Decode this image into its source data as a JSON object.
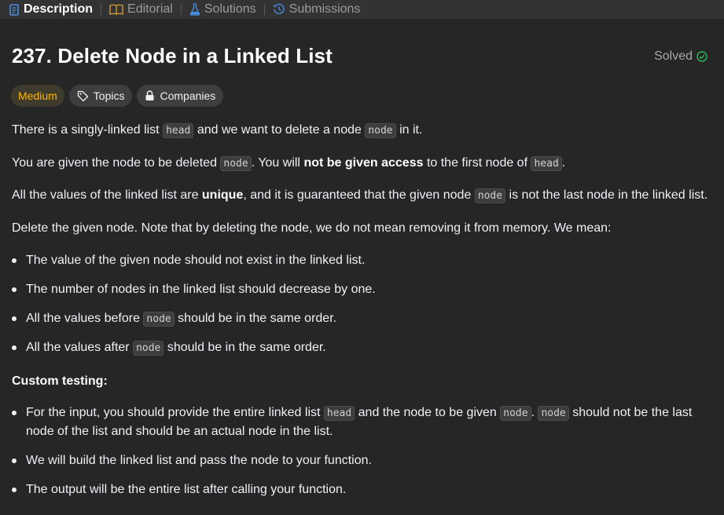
{
  "tabs": [
    {
      "label": "Description",
      "icon": "description-icon",
      "active": true
    },
    {
      "label": "Editorial",
      "icon": "book-icon",
      "active": false
    },
    {
      "label": "Solutions",
      "icon": "flask-icon",
      "active": false
    },
    {
      "label": "Submissions",
      "icon": "history-icon",
      "active": false
    }
  ],
  "problem": {
    "title": "237. Delete Node in a Linked List",
    "status": "Solved",
    "difficulty": "Medium",
    "topics_label": "Topics",
    "companies_label": "Companies"
  },
  "text": {
    "p1a": "There is a singly-linked list ",
    "p1code1": "head",
    "p1b": " and we want to delete a node ",
    "p1code2": "node",
    "p1c": " in it.",
    "p2a": "You are given the node to be deleted ",
    "p2code1": "node",
    "p2b": ". You will ",
    "p2bold": "not be given access",
    "p2c": " to the first node of ",
    "p2code2": "head",
    "p2d": ".",
    "p3a": "All the values of the linked list are ",
    "p3bold": "unique",
    "p3b": ", and it is guaranteed that the given node ",
    "p3code": "node",
    "p3c": " is not the last node in the linked list.",
    "p4": "Delete the given node. Note that by deleting the node, we do not mean removing it from memory. We mean:",
    "b1": "The value of the given node should not exist in the linked list.",
    "b2": "The number of nodes in the linked list should decrease by one.",
    "b3a": "All the values before ",
    "b3code": "node",
    "b3b": " should be in the same order.",
    "b4a": "All the values after ",
    "b4code": "node",
    "b4b": " should be in the same order.",
    "custom": "Custom testing:",
    "c1a": "For the input, you should provide the entire linked list ",
    "c1code1": "head",
    "c1b": " and the node to be given ",
    "c1code2": "node",
    "c1c": ". ",
    "c1code3": "node",
    "c1d": " should not be the last",
    "c1e": "node of the list and should be an actual node in the list.",
    "c2": "We will build the linked list and pass the node to your function.",
    "c3": "The output will be the entire list after calling your function."
  },
  "colors": {
    "background": "#262626",
    "tabbar": "#333333",
    "medium": "#ffb800",
    "solved_check": "#2cbb5d",
    "active_tab_icon": "#4a90e2"
  }
}
